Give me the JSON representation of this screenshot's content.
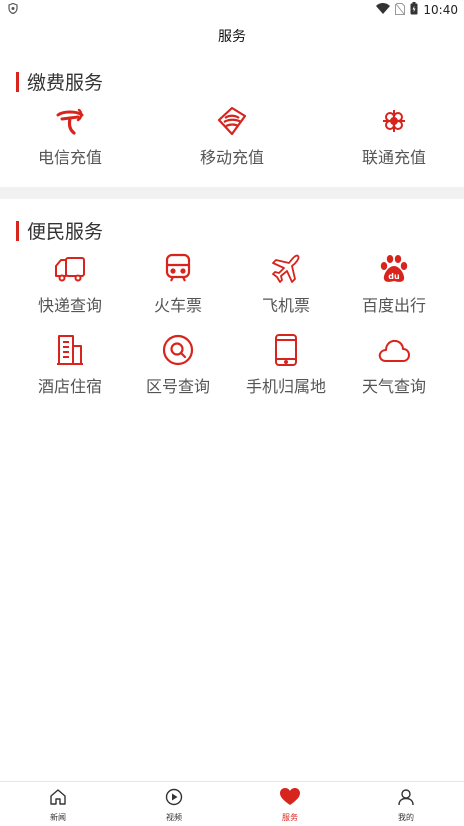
{
  "status": {
    "time": "10:40"
  },
  "header": {
    "title": "服务"
  },
  "sections": [
    {
      "title": "缴费服务",
      "items": [
        {
          "label": "电信充值",
          "icon": "china-telecom-icon"
        },
        {
          "label": "移动充值",
          "icon": "china-mobile-icon"
        },
        {
          "label": "联通充值",
          "icon": "china-unicom-icon"
        }
      ]
    },
    {
      "title": "便民服务",
      "items": [
        {
          "label": "快递查询",
          "icon": "truck-icon"
        },
        {
          "label": "火车票",
          "icon": "train-icon"
        },
        {
          "label": "飞机票",
          "icon": "airplane-icon"
        },
        {
          "label": "百度出行",
          "icon": "baidu-icon"
        },
        {
          "label": "酒店住宿",
          "icon": "hotel-icon"
        },
        {
          "label": "区号查询",
          "icon": "search-icon"
        },
        {
          "label": "手机归属地",
          "icon": "phone-icon"
        },
        {
          "label": "天气查询",
          "icon": "cloud-icon"
        }
      ]
    }
  ],
  "nav": [
    {
      "label": "新闻",
      "icon": "home-icon"
    },
    {
      "label": "视频",
      "icon": "play-icon"
    },
    {
      "label": "服务",
      "icon": "heart-icon",
      "active": true
    },
    {
      "label": "我的",
      "icon": "user-icon"
    }
  ],
  "colors": {
    "accent": "#d7251e",
    "divider": "#f1f1f1"
  }
}
